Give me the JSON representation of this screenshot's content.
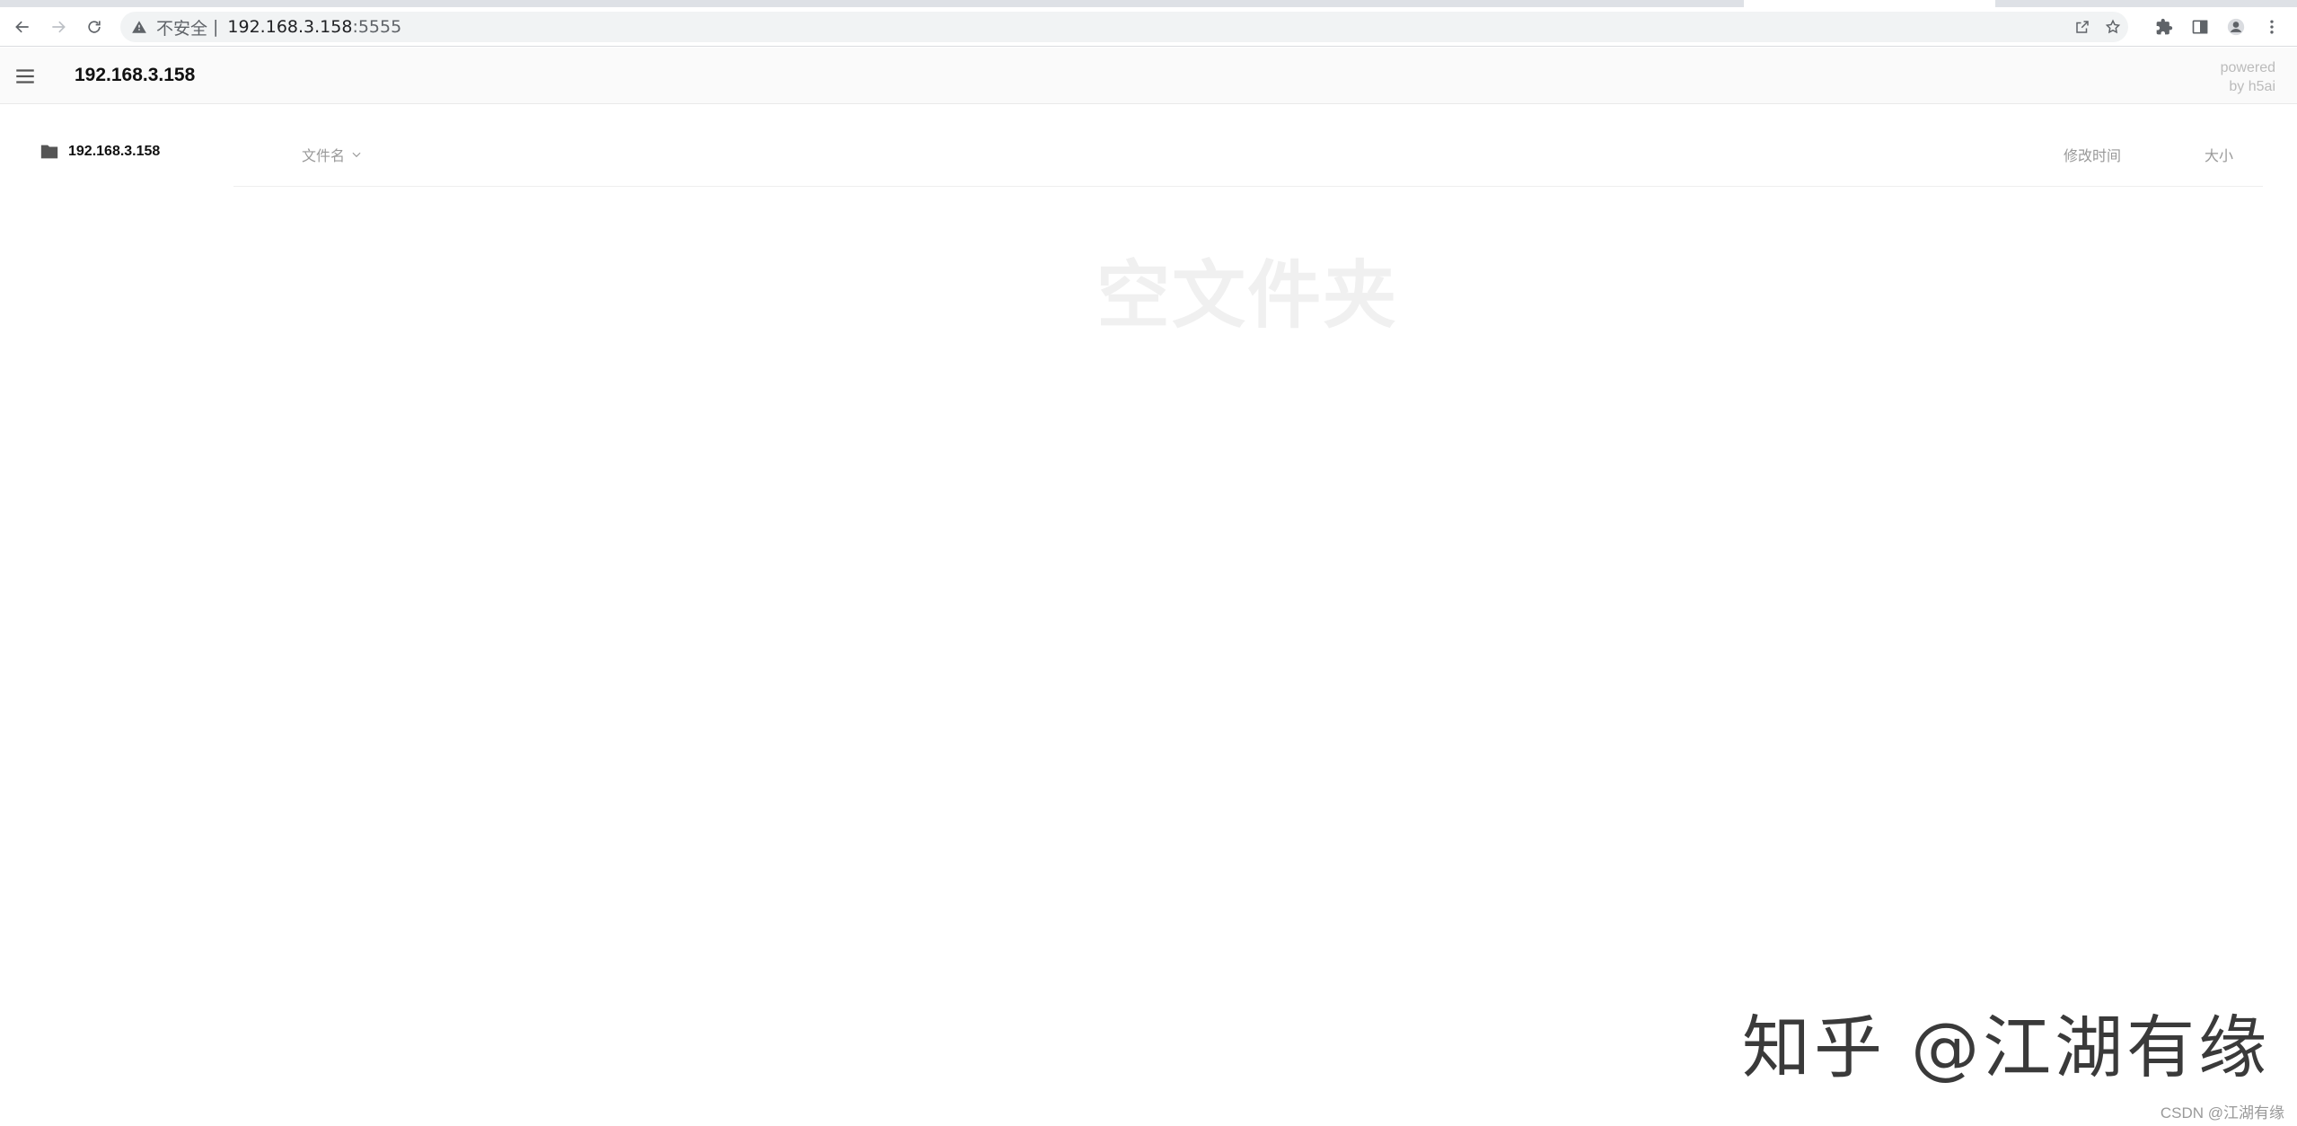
{
  "browser": {
    "security_label": "不安全",
    "separator": "|",
    "url_host": "192.168.3.158",
    "url_port": ":5555"
  },
  "header": {
    "title": "192.168.3.158",
    "powered_line1": "powered",
    "powered_line2": "by h5ai"
  },
  "sidebar": {
    "items": [
      {
        "label": "192.168.3.158"
      }
    ]
  },
  "listing": {
    "columns": {
      "name": "文件名",
      "date": "修改时间",
      "size": "大小"
    },
    "empty_message": "空文件夹"
  },
  "watermarks": {
    "zhihu": "知乎 @江湖有缘",
    "csdn": "CSDN @江湖有缘"
  }
}
